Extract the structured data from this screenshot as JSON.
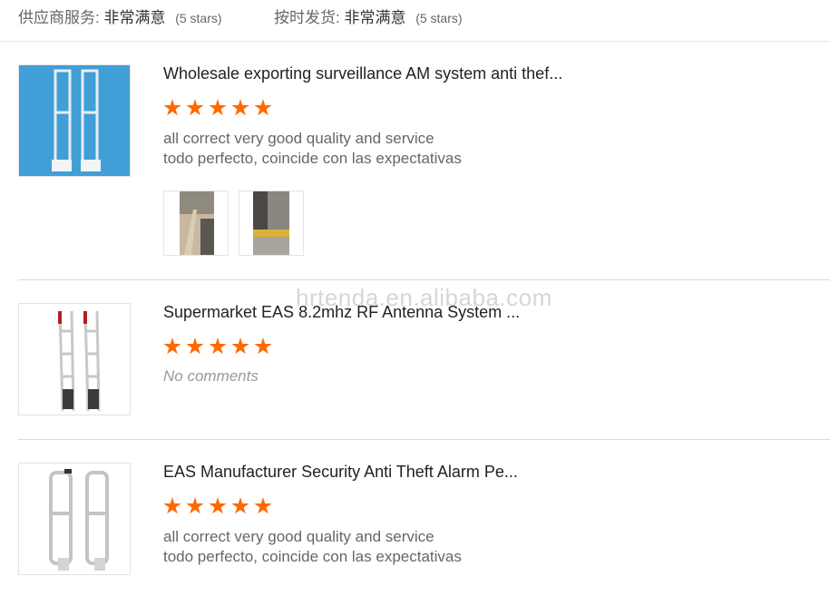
{
  "ratings": [
    {
      "label": "供应商服务:",
      "value": "非常满意",
      "stars": "(5 stars)"
    },
    {
      "label": "按时发货:",
      "value": "非常满意",
      "stars": "(5 stars)"
    }
  ],
  "reviews": [
    {
      "title": "Wholesale exporting surveillance AM system anti thef...",
      "rating": 5,
      "comment_line1": "all correct very good quality and service",
      "comment_line2": "todo perfecto, coincide con las expectativas",
      "photo_count": 2
    },
    {
      "title": "Supermarket EAS 8.2mhz RF Antenna System ...",
      "rating": 5,
      "comment_line1": "No comments"
    },
    {
      "title": "EAS Manufacturer Security Anti Theft Alarm Pe...",
      "rating": 5,
      "comment_line1": "all correct very good quality and service",
      "comment_line2": "todo perfecto, coincide con las expectativas"
    }
  ],
  "watermark": "hrtenda.en.alibaba.com",
  "colors": {
    "star": "#ff6a00",
    "thumb_bg_1": "#3f9fd6"
  }
}
